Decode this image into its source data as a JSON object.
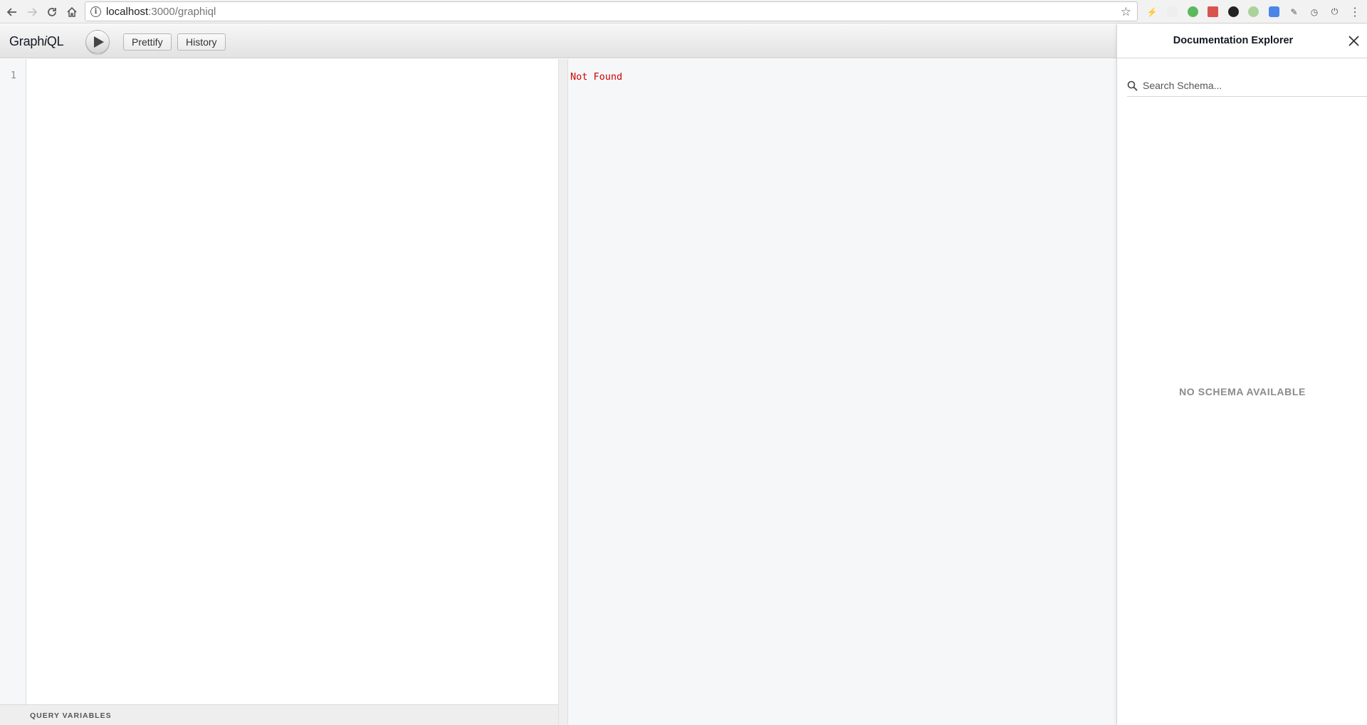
{
  "browser": {
    "url_host": "localhost",
    "url_path": ":3000/graphiql"
  },
  "app": {
    "title_prefix": "Graph",
    "title_italic": "i",
    "title_suffix": "QL"
  },
  "toolbar": {
    "prettify_label": "Prettify",
    "history_label": "History"
  },
  "editor": {
    "line_number": "1",
    "query_variables_label": "QUERY VARIABLES"
  },
  "result": {
    "text": "Not Found",
    "text_color": "#d40000"
  },
  "docs": {
    "title": "Documentation Explorer",
    "search_placeholder": "Search Schema...",
    "empty_message": "NO SCHEMA AVAILABLE"
  },
  "icons": [
    "back-icon",
    "forward-icon",
    "reload-icon",
    "home-icon",
    "info-icon",
    "star-icon",
    "play-icon",
    "close-icon",
    "search-icon"
  ]
}
